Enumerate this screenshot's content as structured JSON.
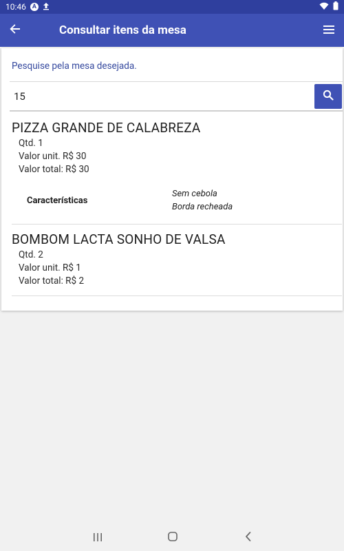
{
  "status_bar": {
    "time": "10:46",
    "notification_badge": "A"
  },
  "app_bar": {
    "title": "Consultar itens da mesa"
  },
  "search": {
    "hint": "Pesquise pela mesa desejada.",
    "value": "15"
  },
  "items": [
    {
      "name": "PIZZA GRANDE DE CALABREZA",
      "qty": "Qtd. 1",
      "unit_price": "Valor unit. R$ 30",
      "total_price": "Valor total: R$ 30",
      "features_label": "Características",
      "features": [
        "Sem cebola",
        "Borda recheada"
      ]
    },
    {
      "name": "BOMBOM LACTA SONHO DE VALSA",
      "qty": "Qtd. 2",
      "unit_price": "Valor unit. R$ 1",
      "total_price": "Valor total: R$ 2"
    }
  ],
  "icons": {
    "back": "arrow-back-icon",
    "menu": "hamburger-menu-icon",
    "search": "search-icon",
    "upload": "upload-icon",
    "wifi": "wifi-icon",
    "battery": "battery-icon",
    "nav_recent": "recent-apps-icon",
    "nav_home": "home-icon",
    "nav_back": "nav-back-icon"
  },
  "colors": {
    "primary": "#3f51b5",
    "status_bar": "#2f3f9e",
    "hint_text": "#34489e"
  }
}
